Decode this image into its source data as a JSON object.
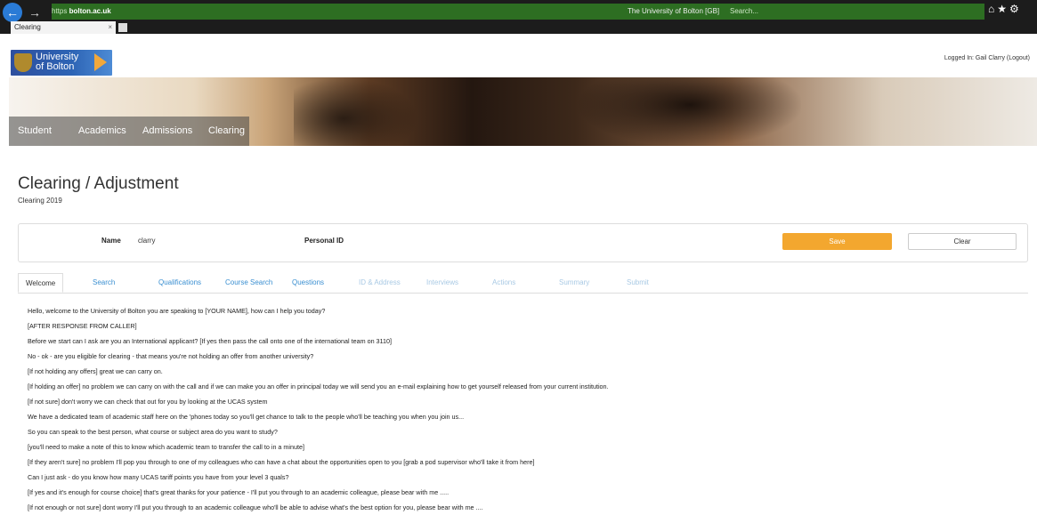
{
  "browser": {
    "url_scheme": "https",
    "url_host": "bolton.ac.uk",
    "site_identity": "The University of Bolton [GB]",
    "search_placeholder": "Search...",
    "tab_title": "Clearing",
    "tab_close": "×"
  },
  "header": {
    "logo_line1": "University",
    "logo_line2": "of Bolton",
    "logged_in": "Logged In: Gail Clarry (Logout)"
  },
  "hero_nav": {
    "items": [
      "Student",
      "Academics",
      "Admissions",
      "Clearing"
    ]
  },
  "page": {
    "title": "Clearing / Adjustment",
    "subtitle": "Clearing 2019"
  },
  "form": {
    "name_label": "Name",
    "name_value": "clarry",
    "personal_id_label": "Personal ID",
    "save_label": "Save",
    "clear_label": "Clear"
  },
  "tabs": [
    {
      "label": "Welcome",
      "state": "active"
    },
    {
      "label": "Search",
      "state": "enabled"
    },
    {
      "label": "Qualifications",
      "state": "enabled"
    },
    {
      "label": "Course Search",
      "state": "enabled"
    },
    {
      "label": "Questions",
      "state": "enabled"
    },
    {
      "label": "ID & Address",
      "state": "disabled"
    },
    {
      "label": "Interviews",
      "state": "disabled"
    },
    {
      "label": "Actions",
      "state": "disabled"
    },
    {
      "label": "Summary",
      "state": "disabled"
    },
    {
      "label": "Submit",
      "state": "disabled"
    }
  ],
  "script_lines": [
    "Hello, welcome to the University of Bolton you are speaking to [YOUR NAME], how can I help you today?",
    "[AFTER RESPONSE FROM CALLER]",
    "Before we start can I ask are you an International applicant? [If yes then pass the call onto one of the international team on 3110]",
    "No - ok - are you eligible for clearing - that means you're not holding an offer from another university?",
    "[If not holding any offers] great we can carry on.",
    "[If holding an offer] no problem we can carry on with the call and if we can make you an offer in principal today we will send you an e-mail explaining how to get yourself released from your current institution.",
    "[If not sure] don't worry we can check that out for you by looking at the UCAS system",
    "We have a dedicated team of academic staff here on the 'phones today so you'll get chance to talk to the people who'll be teaching you when you join us...",
    "So you can speak to the best person, what course or subject area do you want to study?",
    "[you'll need to make a note of this to know which academic team to transfer the call to in a minute]",
    "[If they aren't sure] no problem I'll pop you through to one of my colleagues who can have a chat about the opportunities open to you [grab a pod supervisor who'll take it from here]",
    "Can I just ask - do you know how many UCAS tariff points you have from your level 3 quals?",
    "[If yes and it's enough for course choice] that's great thanks for your patience - I'll put you through to an academic colleague, please bear with me .....",
    "[If not enough or not sure] dont worry I'll put you through to an academic colleague who'll be able to advise what's the best option for you, please bear with me ...."
  ],
  "colors": {
    "accent_orange": "#f3a72f",
    "tab_link_blue": "#3a8fd1",
    "tab_disabled_blue": "#a8c9e4",
    "logo_blue": "#2d64b5"
  }
}
